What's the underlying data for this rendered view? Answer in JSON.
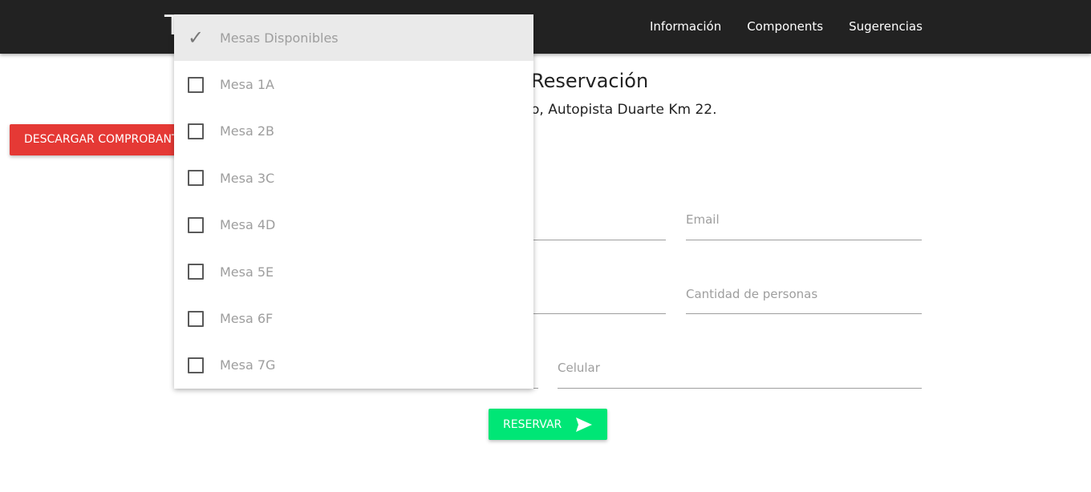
{
  "navbar": {
    "brand": "T",
    "links": [
      "Información",
      "Components",
      "Sugerencias"
    ]
  },
  "page": {
    "heading": "Reservación",
    "subtitle": "o, Autopista Duarte Km 22."
  },
  "buttons": {
    "download": "DESCARGAR COMPROBANTE",
    "reserve": "RESERVAR"
  },
  "form": {
    "email": "Email",
    "people": "Cantidad de personas",
    "phone": "Celular"
  },
  "dropdown": {
    "header": "Mesas Disponibles",
    "options": [
      "Mesa 1A",
      "Mesa 2B",
      "Mesa 3C",
      "Mesa 4D",
      "Mesa 5E",
      "Mesa 6F",
      "Mesa 7G"
    ]
  },
  "colors": {
    "navbar": "#222222",
    "download": "#e53935",
    "reserve": "#00e676"
  }
}
